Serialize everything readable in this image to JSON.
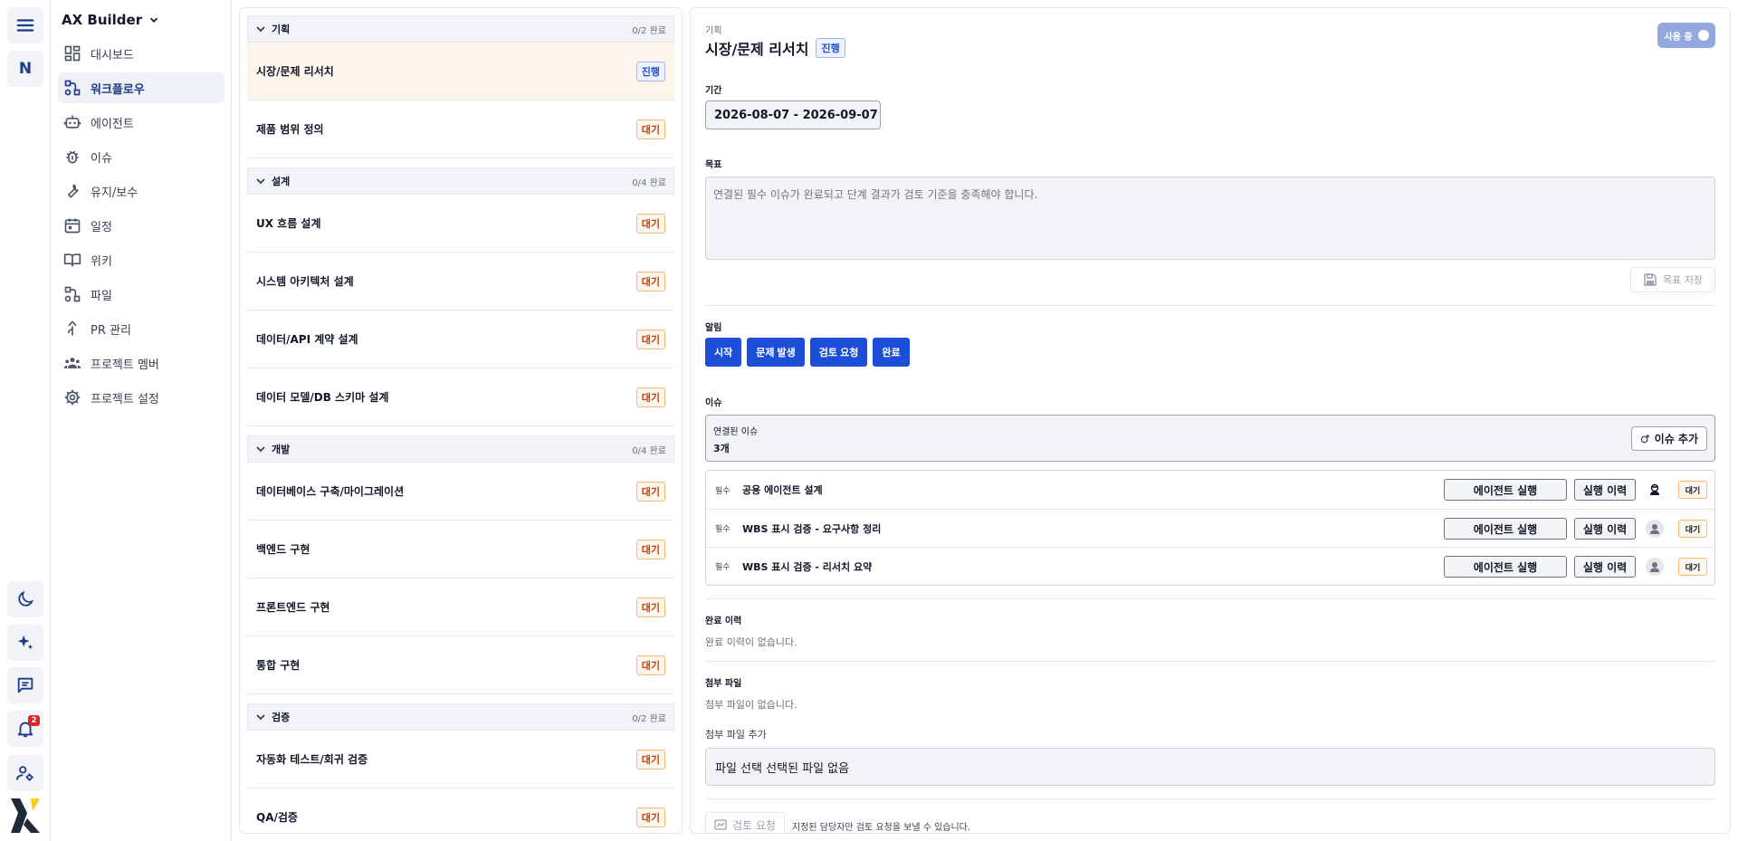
{
  "rail": {
    "workspace_initial": "N",
    "notification_count": "2",
    "accent": "#1e3a8a"
  },
  "sidebar": {
    "project_name": "AX Builder",
    "items": [
      {
        "label": "대시보드",
        "icon": "dashboard-icon"
      },
      {
        "label": "워크플로우",
        "icon": "workflow-icon",
        "active": true
      },
      {
        "label": "에이전트",
        "icon": "robot-icon"
      },
      {
        "label": "이슈",
        "icon": "bug-icon"
      },
      {
        "label": "유지/보수",
        "icon": "wrench-icon"
      },
      {
        "label": "일정",
        "icon": "calendar-icon"
      },
      {
        "label": "위키",
        "icon": "book-icon"
      },
      {
        "label": "파일",
        "icon": "files-icon"
      },
      {
        "label": "PR 관리",
        "icon": "merge-icon"
      },
      {
        "label": "프로젝트 멤버",
        "icon": "members-icon"
      },
      {
        "label": "프로젝트 설정",
        "icon": "settings-icon"
      }
    ]
  },
  "workflow": {
    "phases": [
      {
        "name": "기획",
        "count": "0/2 완료"
      },
      {
        "name": "설계",
        "count": "0/4 완료"
      },
      {
        "name": "개발",
        "count": "0/4 완료"
      },
      {
        "name": "검증",
        "count": "0/2 완료"
      }
    ],
    "tasks": [
      {
        "name": "시장/문제 리서치",
        "status": "진행"
      },
      {
        "name": "제품 범위 정의",
        "status": "대기"
      },
      {
        "name": "UX 흐름 설계",
        "status": "대기"
      },
      {
        "name": "시스템 아키텍처 설계",
        "status": "대기"
      },
      {
        "name": "데이터/API 계약 설계",
        "status": "대기"
      },
      {
        "name": "데이터 모델/DB 스키마 설계",
        "status": "대기"
      },
      {
        "name": "데이터베이스 구축/마이그레이션",
        "status": "대기"
      },
      {
        "name": "백엔드 구현",
        "status": "대기"
      },
      {
        "name": "프론트엔드 구현",
        "status": "대기"
      },
      {
        "name": "통합 구현",
        "status": "대기"
      },
      {
        "name": "자동화 테스트/회귀 검증",
        "status": "대기"
      },
      {
        "name": "QA/검증",
        "status": "대기"
      }
    ]
  },
  "detail": {
    "breadcrumb": "기획",
    "title": "시장/문제 리서치",
    "status": "진행",
    "toggle_label": "사용 중",
    "period_label": "기간",
    "period_value": "2026-08-07 - 2026-09-07",
    "goal_label": "목표",
    "goal_placeholder": "연결된 필수 이슈가 완료되고 단계 결과가 검토 기준을 충족해야 합니다.",
    "save_goal": "목표 저장",
    "alerts_label": "알림",
    "alert_buttons": [
      "시작",
      "문제 발생",
      "검토 요청",
      "완료"
    ],
    "issues_label": "이슈",
    "linked_label": "연결된 이슈",
    "linked_count": "3개",
    "add_issue": "이슈 추가",
    "issue_rows": [
      {
        "required": "필수",
        "title": "공용 에이전트 설계",
        "run": "에이전트 실행",
        "history": "실행 이력",
        "status": "대기"
      },
      {
        "required": "필수",
        "title": "WBS 표시 검증 - 요구사항 정리",
        "run": "에이전트 실행",
        "history": "실행 이력",
        "status": "대기"
      },
      {
        "required": "필수",
        "title": "WBS 표시 검증 - 리서치 요약",
        "run": "에이전트 실행",
        "history": "실행 이력",
        "status": "대기"
      }
    ],
    "history_label": "완료 이력",
    "history_empty": "완료 이력이 없습니다.",
    "attach_label": "첨부 파일",
    "attach_empty": "첨부 파일이 없습니다.",
    "attach_add_label": "첨부 파일 추가",
    "file_input_text": "파일 선택 선택된 파일 없음",
    "review_button": "검토 요청",
    "review_note": "지정된 담당자만 검토 요청을 보낼 수 있습니다."
  }
}
